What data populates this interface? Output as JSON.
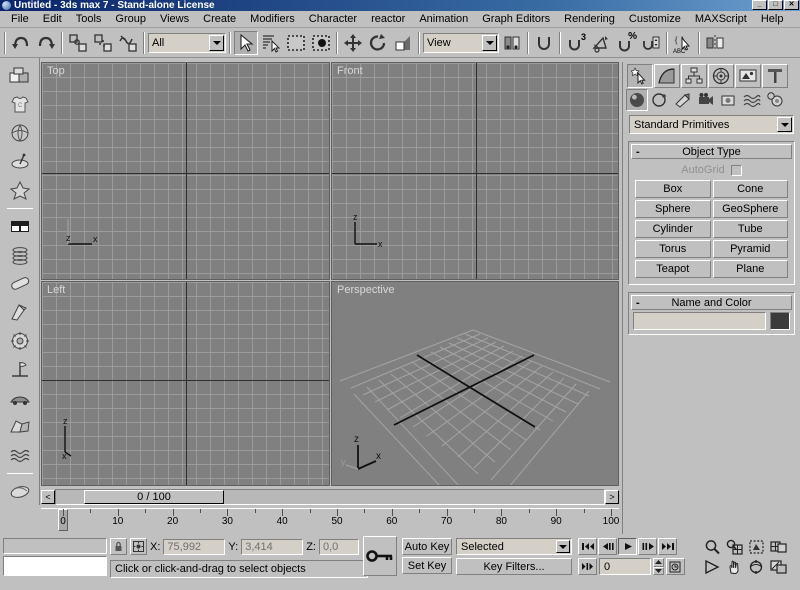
{
  "window": {
    "title": "Untitled - 3ds max 7 - Stand-alone License",
    "buttons": {
      "minimize": "_",
      "maximize": "□",
      "close": "✕"
    }
  },
  "menubar": {
    "items": [
      {
        "label": "File"
      },
      {
        "label": "Edit"
      },
      {
        "label": "Tools"
      },
      {
        "label": "Group"
      },
      {
        "label": "Views"
      },
      {
        "label": "Create"
      },
      {
        "label": "Modifiers"
      },
      {
        "label": "Character"
      },
      {
        "label": "reactor"
      },
      {
        "label": "Animation"
      },
      {
        "label": "Graph Editors"
      },
      {
        "label": "Rendering"
      },
      {
        "label": "Customize"
      },
      {
        "label": "MAXScript"
      },
      {
        "label": "Help"
      }
    ]
  },
  "toolbar": {
    "undo_tip": "Undo",
    "redo_tip": "Redo",
    "select_link_tip": "Select and Link",
    "unlink_tip": "Unlink Selection",
    "bind_spacewarp_tip": "Bind to Space Warp",
    "selection_filter_value": "All",
    "select_object_tip": "Select Object",
    "select_by_name_tip": "Select by Name",
    "select_region_tip": "Rectangular Selection Region",
    "window_crossing_tip": "Window / Crossing",
    "select_move_tip": "Select and Move",
    "select_rotate_tip": "Select and Rotate",
    "select_scale_tip": "Select and Uniform Scale",
    "reference_coord_value": "View",
    "use_center_tip": "Use Pivot Point Center",
    "mirror_tip": "Mirror",
    "snap_toggle_tip": "Snaps Toggle",
    "snap_degree": "3",
    "angle_snap_tip": "Angle Snap Toggle",
    "percent_snap_label": "%",
    "spinner_snap_tip": "Spinner Snap Toggle",
    "named_selection_label": "ABC"
  },
  "leftbar": {
    "items": [
      {
        "name": "boxes-icon",
        "tip": "Geometry"
      },
      {
        "name": "shirt-icon",
        "tip": "Cloth"
      },
      {
        "name": "ball-icon",
        "tip": "Rigid Body"
      },
      {
        "name": "spinner-icon",
        "tip": "Toy"
      },
      {
        "name": "star-figure-icon",
        "tip": "Soft Body"
      },
      {
        "name": "block-icon",
        "tip": "Constraint"
      },
      {
        "name": "coil-icon",
        "tip": "Spring"
      },
      {
        "name": "capsule-icon",
        "tip": "Dashpot"
      },
      {
        "name": "wedge-icon",
        "tip": "Motor"
      },
      {
        "name": "gear-icon",
        "tip": "Wind"
      },
      {
        "name": "weathervane-icon",
        "tip": "Plane"
      },
      {
        "name": "car-icon",
        "tip": "Vehicle"
      },
      {
        "name": "fracture-icon",
        "tip": "Fracture"
      },
      {
        "name": "water-icon",
        "tip": "Water"
      },
      {
        "name": "deflector-icon",
        "tip": "Deflector"
      }
    ]
  },
  "viewports": [
    {
      "label": "Top",
      "axes": [
        "z",
        "x"
      ],
      "type": "ortho"
    },
    {
      "label": "Front",
      "axes": [
        "z",
        "x"
      ],
      "type": "ortho"
    },
    {
      "label": "Left",
      "axes": [
        "z",
        "x"
      ],
      "type": "ortho"
    },
    {
      "label": "Perspective",
      "axes": [
        "z",
        "x",
        "y"
      ],
      "type": "perspective"
    }
  ],
  "timeline": {
    "slider_label": "0 / 100",
    "prev_arrow": "<",
    "next_arrow": ">",
    "current_frame": 0,
    "range_start": 0,
    "range_end": 100,
    "tick_labels": [
      0,
      10,
      20,
      30,
      40,
      50,
      60,
      70,
      80,
      90,
      100
    ]
  },
  "command_panel": {
    "tabs": [
      {
        "name": "create-tab",
        "icon": "star-arrow-icon",
        "selected": true
      },
      {
        "name": "modify-tab",
        "icon": "curve-icon",
        "selected": false
      },
      {
        "name": "hierarchy-tab",
        "icon": "hierarchy-icon",
        "selected": false
      },
      {
        "name": "motion-tab",
        "icon": "wheel-icon",
        "selected": false
      },
      {
        "name": "display-tab",
        "icon": "monitor-icon",
        "selected": false
      },
      {
        "name": "utilities-tab",
        "icon": "hammer-icon",
        "selected": false
      }
    ],
    "categories": [
      {
        "name": "geometry-category",
        "icon": "sphere-icon",
        "selected": true
      },
      {
        "name": "shapes-category",
        "icon": "shapes-icon",
        "selected": false
      },
      {
        "name": "lights-category",
        "icon": "light-icon",
        "selected": false
      },
      {
        "name": "cameras-category",
        "icon": "camera-icon",
        "selected": false
      },
      {
        "name": "helpers-category",
        "icon": "helper-icon",
        "selected": false
      },
      {
        "name": "spacewarps-category",
        "icon": "wave-icon",
        "selected": false
      },
      {
        "name": "systems-category",
        "icon": "gears-icon",
        "selected": false
      }
    ],
    "subcategory_value": "Standard Primitives",
    "object_type": {
      "title": "Object Type",
      "collapse_glyph": "-",
      "autogrid_label": "AutoGrid",
      "autogrid_checked": false,
      "buttons": [
        "Box",
        "Cone",
        "Sphere",
        "GeoSphere",
        "Cylinder",
        "Tube",
        "Torus",
        "Pyramid",
        "Teapot",
        "Plane"
      ]
    },
    "name_and_color": {
      "title": "Name and Color",
      "collapse_glyph": "-",
      "name_value": "",
      "color_hex": "#3b3b3b"
    }
  },
  "status_bar": {
    "lock_tip": "Selection Lock Toggle",
    "abs_rel_tip": "Absolute Mode Transform Type-In",
    "x_label": "X:",
    "x_value": "75,992",
    "y_label": "Y:",
    "y_value": "3,414",
    "z_label": "Z:",
    "z_value": "0,0",
    "prompt_text": "Click or click-and-drag to select objects",
    "mini_listener_value": "",
    "status_line_value": ""
  },
  "animation": {
    "key_mode_tip": "Set Key Mode toggle",
    "auto_key_label": "Auto Key",
    "set_key_label": "Set Key",
    "selection_set_value": "Selected",
    "key_filters_label": "Key Filters...",
    "current_frame_value": "0",
    "playback": [
      {
        "name": "go-to-start-button",
        "glyph": "⏮"
      },
      {
        "name": "previous-frame-button",
        "glyph": "◀"
      },
      {
        "name": "play-button",
        "glyph": "▶"
      },
      {
        "name": "next-frame-button",
        "glyph": "▶"
      },
      {
        "name": "go-to-end-button",
        "glyph": "⏭"
      }
    ],
    "key_mode_glyph": "⇥",
    "time_config_tip": "Time Configuration"
  },
  "viewport_nav": {
    "row1": [
      {
        "name": "zoom-button",
        "icon": "magnifier-icon"
      },
      {
        "name": "zoom-all-button",
        "icon": "zoom-all-icon"
      },
      {
        "name": "zoom-extents-button",
        "icon": "zoom-extents-icon"
      },
      {
        "name": "zoom-extents-all-button",
        "icon": "zoom-extents-all-icon"
      }
    ],
    "row2": [
      {
        "name": "field-of-view-button",
        "icon": "fov-icon"
      },
      {
        "name": "pan-button",
        "icon": "hand-icon"
      },
      {
        "name": "arc-rotate-button",
        "icon": "arc-rotate-icon"
      },
      {
        "name": "min-max-toggle-button",
        "icon": "maximize-viewport-icon"
      }
    ]
  },
  "colors": {
    "face": "#c0c0c0",
    "viewport_bg": "#808080",
    "grid_line": "#a0a0a0",
    "axis_line": "#303030",
    "title_gradient_start": "#0a246a",
    "field_bg": "#d4d0c8"
  }
}
